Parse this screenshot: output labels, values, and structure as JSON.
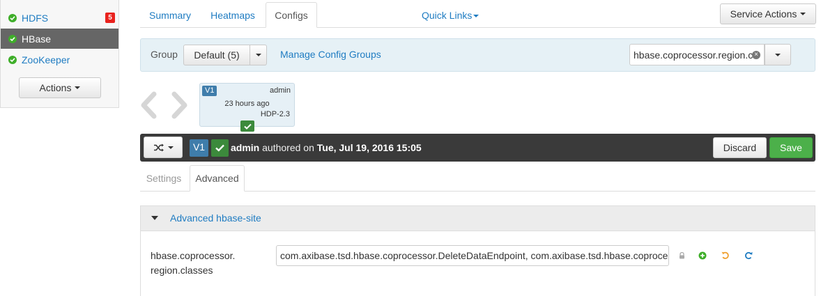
{
  "services": [
    {
      "name": "HDFS",
      "status": "ok",
      "alerts": "5",
      "active": false
    },
    {
      "name": "HBase",
      "status": "ok",
      "alerts": "",
      "active": true
    },
    {
      "name": "ZooKeeper",
      "status": "ok",
      "alerts": "",
      "active": false
    }
  ],
  "sidebar": {
    "actions_label": "Actions"
  },
  "top_tabs": [
    {
      "label": "Summary"
    },
    {
      "label": "Heatmaps"
    },
    {
      "label": "Configs",
      "active": true
    }
  ],
  "quick_links_label": "Quick Links",
  "service_actions_label": "Service Actions",
  "group_bar": {
    "label": "Group",
    "selected_group": "Default (5)",
    "manage_link": "Manage Config Groups",
    "filter_value": "hbase.coprocessor.region.c"
  },
  "version_card": {
    "version": "V1",
    "author": "admin",
    "time_ago": "23 hours ago",
    "stack": "HDP-2.3"
  },
  "version_bar": {
    "version": "V1",
    "author": "admin",
    "authored_text": "authored on",
    "date": "Tue, Jul 19, 2016 15:05",
    "discard_label": "Discard",
    "save_label": "Save"
  },
  "sub_tabs": [
    {
      "label": "Settings"
    },
    {
      "label": "Advanced",
      "active": true
    }
  ],
  "section": {
    "title": "Advanced hbase-site",
    "property": {
      "name_line1": "hbase.coprocessor.",
      "name_line2": "region.classes",
      "value": "com.axibase.tsd.hbase.coprocessor.DeleteDataEndpoint, com.axibase.tsd.hbase.coprocessor.CompactRawDataEndpoint"
    }
  },
  "colors": {
    "link": "#1f7cc2",
    "ok": "#3fae2a",
    "alert": "#e9221d",
    "save": "#4cb04a",
    "version_badge": "#3f7dab",
    "dark_bar": "#3a3a3a"
  }
}
